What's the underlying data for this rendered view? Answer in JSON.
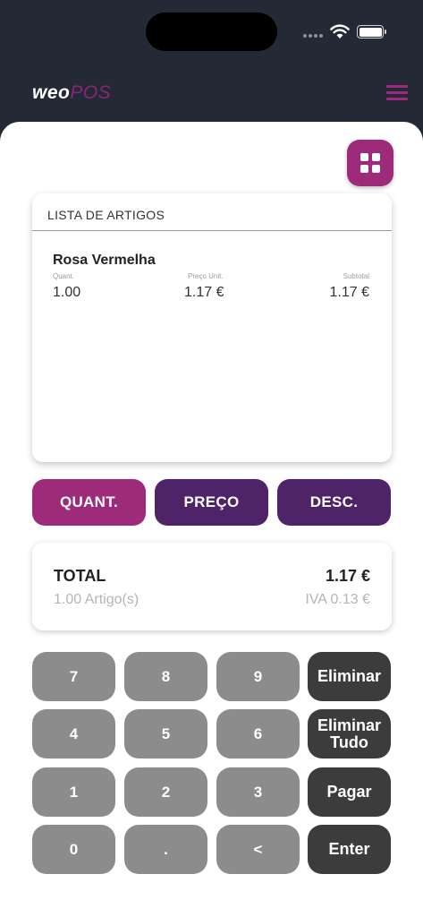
{
  "header": {
    "logo_primary": "weo",
    "logo_secondary": "POS"
  },
  "article_list": {
    "title": "LISTA DE ARTIGOS",
    "items": [
      {
        "name": "Rosa Vermelha",
        "qty_label": "Quant.",
        "unit_price_label": "Preço Unit.",
        "subtotal_label": "Subtotal",
        "qty": "1.00",
        "unit_price": "1.17 €",
        "subtotal": "1.17 €"
      }
    ]
  },
  "modes": {
    "quantity": "QUANT.",
    "price": "PREÇO",
    "discount": "DESC."
  },
  "totals": {
    "label": "TOTAL",
    "value": "1.17 €",
    "count": "1.00 Artigo(s)",
    "vat": "IVA 0.13 €"
  },
  "keypad": {
    "k7": "7",
    "k8": "8",
    "k9": "9",
    "k4": "4",
    "k5": "5",
    "k6": "6",
    "k1": "1",
    "k2": "2",
    "k3": "3",
    "k0": "0",
    "dot": ".",
    "back": "<",
    "delete": "Eliminar",
    "delete_all": "Eliminar Tudo",
    "pay": "Pagar",
    "enter": "Enter"
  },
  "colors": {
    "brand_magenta": "#9e2a7a",
    "brand_purple": "#4f2368",
    "header_bg": "#242a35",
    "key_light": "#8c8c8c",
    "key_dark": "#3c3c3c"
  },
  "icons": [
    "wifi-icon",
    "battery-icon",
    "menu-icon",
    "grid-icon"
  ]
}
